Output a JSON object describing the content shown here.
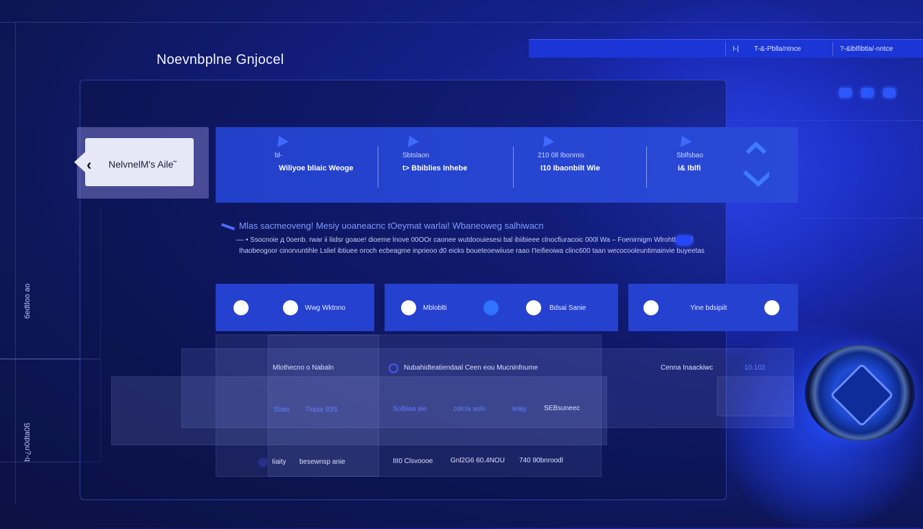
{
  "app": {
    "title": "Noevnbplne Gnjocel"
  },
  "topbar": {
    "items": [
      "I-|",
      "T-&-Pblla/ntnce",
      "?-&lblfibtla/-nntce"
    ]
  },
  "back": {
    "label": "NelvnelM's Aile˜"
  },
  "stats": [
    {
      "small": "bl-",
      "big": "Wiliyoe bliaic Weoge"
    },
    {
      "small": "Sbtslaon",
      "big": "t> Bbiblies Inhebe"
    },
    {
      "small": "210 0Il Ibonmis",
      "big": "I10 Ibaonbilt Wie"
    },
    {
      "small": "Sblfsbao",
      "big": "i& Iblfi"
    }
  ],
  "section": {
    "title": "Mlas sacmeoveng! Mesiy uoaneacnc tOeymat warlai! Wbaneoweg salhiwacn",
    "line1": "–– • Ssocnoie д 0oenb. rwar ii liidsr goaoe! dioeme lnove 00OOr caonee wutdoouiesesi bal ibiibieee clnocfiuracoic 000l Wa – Foenirnigm Wlrohtbaend",
    "line2": "Ihaobeogoor cinorvuntihle Lsliel ibtiuee oroch ecbeagme inprieoo d0 eicks boueteoewiiuse raao I'Ieifieoiwa clinc600 taan wecocooleuntimainvie buyeetas"
  },
  "features": {
    "f1": "Wwg Wktnno",
    "f2": "Mbloblti",
    "f3": "Bdsai Sanie",
    "f4": "Yine bdsipiit"
  },
  "table": {
    "h1": "Mlothecno o Nabaln",
    "h2": "Nubahidteatiendaal Ceen eou Mucninfnume",
    "h3": "Cenna Inaackiwc",
    "h4": "10.102",
    "r1a": "Sbao",
    "r1b": "Tiopia 93S",
    "r1c": "Solbiaa aie",
    "r1d": "colcia aolo",
    "r1e": "leaiy",
    "r1f": "SEBsuneec",
    "r2a": "Iiaity",
    "r2b": "besewnsp anie",
    "r2c": "III0 Clsvoooe",
    "r2d": "Gnl2G6 60.4NOU",
    "r2e": "740 90bnroodl"
  },
  "side": {
    "s1": "6edtloo ao",
    "s2": "b-¿n0dta0ß"
  }
}
